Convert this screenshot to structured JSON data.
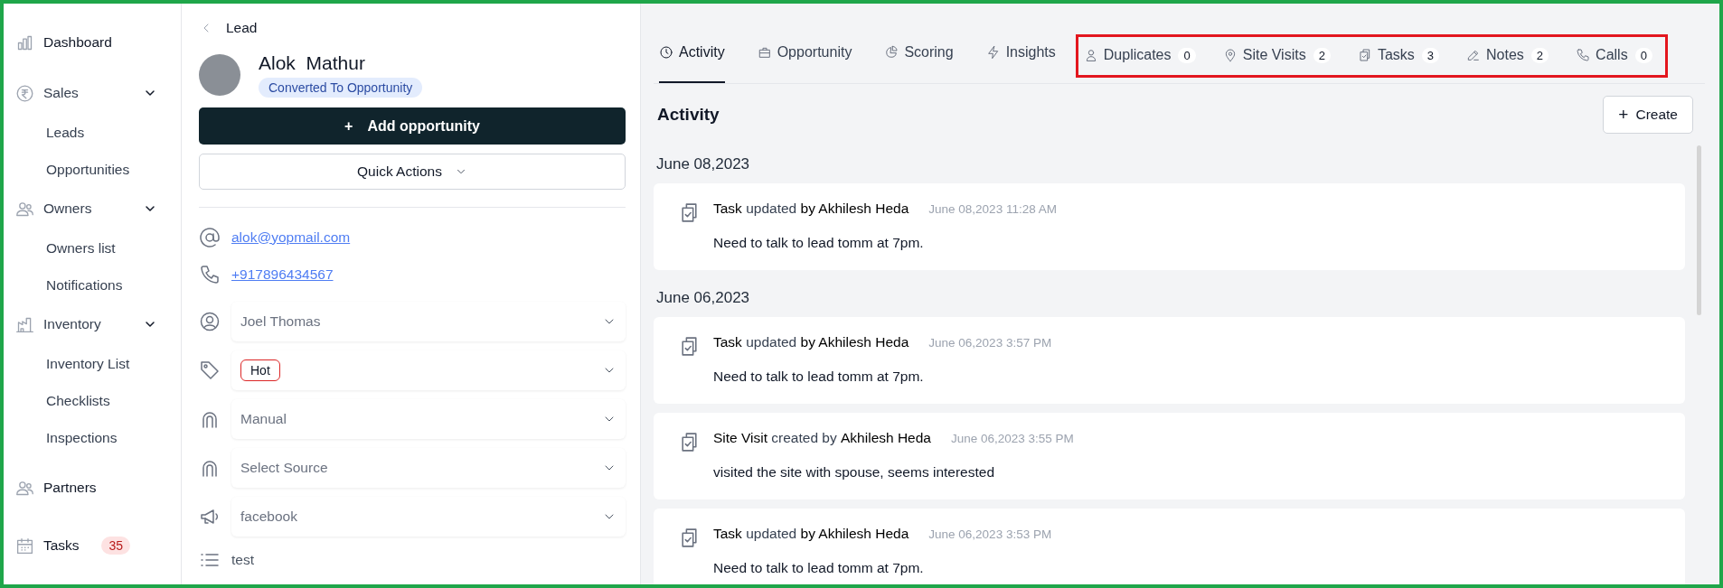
{
  "sidebar": {
    "items": [
      {
        "label": "Dashboard"
      },
      {
        "label": "Sales",
        "expanded": true,
        "children": [
          {
            "label": "Leads"
          },
          {
            "label": "Opportunities"
          }
        ]
      },
      {
        "label": "Owners",
        "expanded": true,
        "children": [
          {
            "label": "Owners list"
          },
          {
            "label": "Notifications"
          }
        ]
      },
      {
        "label": "Inventory",
        "expanded": true,
        "children": [
          {
            "label": "Inventory List"
          },
          {
            "label": "Checklists"
          },
          {
            "label": "Inspections"
          }
        ]
      },
      {
        "label": "Partners"
      },
      {
        "label": "Tasks",
        "badge": "35"
      }
    ]
  },
  "lead": {
    "back_title": "Lead",
    "name": "Alok  Mathur",
    "status": "Converted To Opportunity",
    "add_button": {
      "icon": "+",
      "label": "Add opportunity"
    },
    "quick_actions": "Quick Actions",
    "email": "alok@yopmail.com",
    "phone": "+917896434567",
    "fields": [
      {
        "kind": "select",
        "value": "Joel Thomas"
      },
      {
        "kind": "tag",
        "value": "Hot"
      },
      {
        "kind": "select",
        "value": "Manual"
      },
      {
        "kind": "select",
        "placeholder": "Select Source"
      },
      {
        "kind": "select",
        "value": "facebook"
      },
      {
        "kind": "text",
        "value": "test"
      }
    ]
  },
  "tabs": [
    {
      "label": "Activity",
      "selected": true
    },
    {
      "label": "Opportunity",
      "selected": false
    },
    {
      "label": "Scoring",
      "selected": false
    },
    {
      "label": "Insights",
      "selected": false
    },
    {
      "label": "Duplicates",
      "count": "0",
      "selected": false
    },
    {
      "label": "Site Visits",
      "count": "2",
      "selected": false
    },
    {
      "label": "Tasks",
      "count": "3",
      "selected": false
    },
    {
      "label": "Notes",
      "count": "2",
      "selected": false
    },
    {
      "label": "Calls",
      "count": "0",
      "selected": false
    }
  ],
  "activity": {
    "title": "Activity",
    "create_button": {
      "icon": "+",
      "label": "Create"
    },
    "groups": [
      {
        "date": "June 08,2023",
        "entries": [
          {
            "headline": "**Task** updated **by Akhilesh Heda**",
            "time": "June 08,2023 11:28 AM",
            "note": "Need to talk to lead tomm at 7pm."
          }
        ]
      },
      {
        "date": "June 06,2023",
        "entries": [
          {
            "headline": "**Task** updated **by Akhilesh Heda**",
            "time": "June 06,2023 3:57 PM",
            "note": "Need to talk to lead tomm at 7pm."
          },
          {
            "headline": "**Site Visit** created by **Akhilesh Heda**",
            "time": "June 06,2023 3:55 PM",
            "note": "visited the site with spouse, seems interested"
          },
          {
            "headline": "**Task** updated **by Akhilesh Heda**",
            "time": "June 06,2023 3:53 PM",
            "note": "Need to talk to lead tomm at 7pm."
          }
        ]
      }
    ]
  }
}
